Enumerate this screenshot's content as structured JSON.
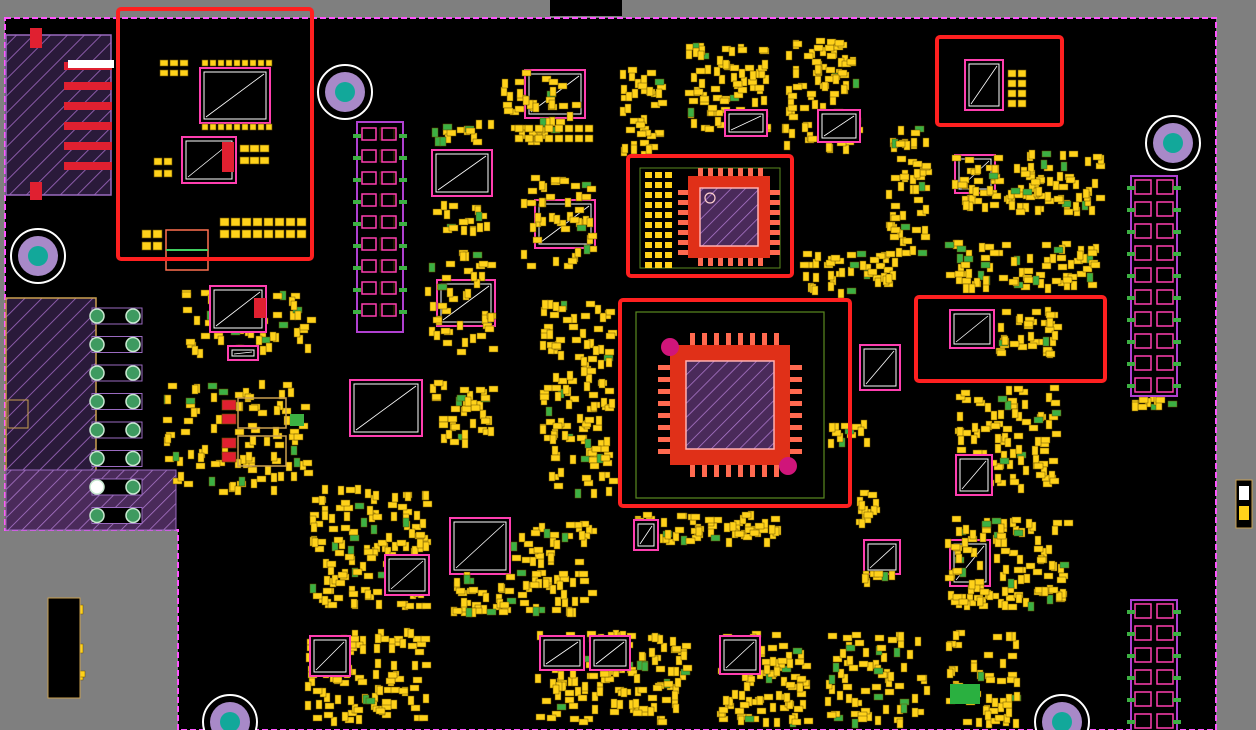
{
  "view": {
    "type": "pcb-layout-editor-canvas",
    "background_color": "#000000",
    "workspace_color": "#7f7f7f",
    "board_outline_color": "#ff55ff",
    "pad_color": "#ffd21a",
    "silkscreen_color": "#ff3fb0",
    "highlight_box_color": "#ff2020",
    "mounting_hole_color": "#12a89a",
    "via_pad_color": "#3cb043"
  },
  "highlights": [
    {
      "name": "highlight-box-1",
      "target": "qfn-component"
    },
    {
      "name": "highlight-box-2",
      "target": "qfp-component"
    },
    {
      "name": "highlight-box-3",
      "target": "small-component-cluster"
    },
    {
      "name": "highlight-box-4",
      "target": "top-left-component-group"
    },
    {
      "name": "highlight-box-5",
      "target": "right-component-cluster"
    }
  ],
  "components": {
    "ic_qfn": {
      "pin_count_per_side": 7
    },
    "ic_qfp": {
      "pin_count_per_side": 8
    }
  }
}
